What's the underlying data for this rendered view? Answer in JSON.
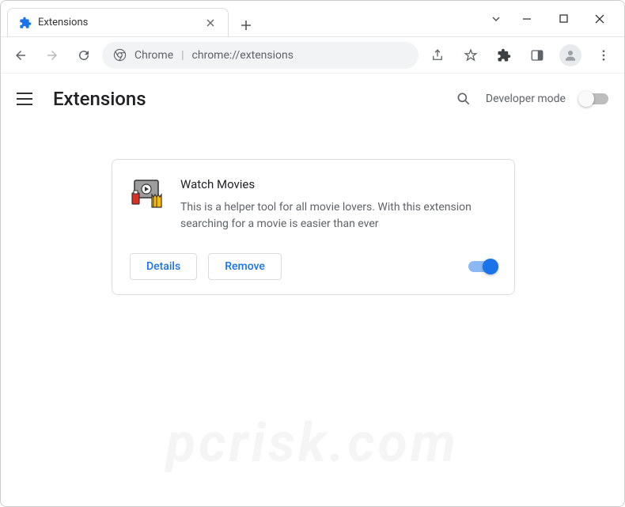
{
  "titlebar": {
    "tab_title": "Extensions"
  },
  "omnibox": {
    "label": "Chrome",
    "path": "chrome://extensions"
  },
  "header": {
    "title": "Extensions",
    "developer_mode": "Developer mode"
  },
  "extension": {
    "name": "Watch Movies",
    "description": "This is a helper tool for all movie lovers. With this extension searching for a movie is easier than ever",
    "details_label": "Details",
    "remove_label": "Remove",
    "enabled": true
  },
  "watermark": "pcrisk.com"
}
